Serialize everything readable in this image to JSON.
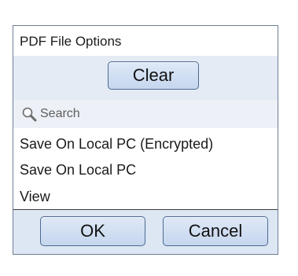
{
  "dialog": {
    "title": "PDF File Options",
    "clear_label": "Clear",
    "search": {
      "placeholder": "Search",
      "value": "",
      "icon": "magnifier-icon"
    },
    "items": [
      {
        "label": "Save On Local PC (Encrypted)"
      },
      {
        "label": "Save On Local PC"
      },
      {
        "label": "View"
      }
    ],
    "ok_label": "OK",
    "cancel_label": "Cancel"
  }
}
